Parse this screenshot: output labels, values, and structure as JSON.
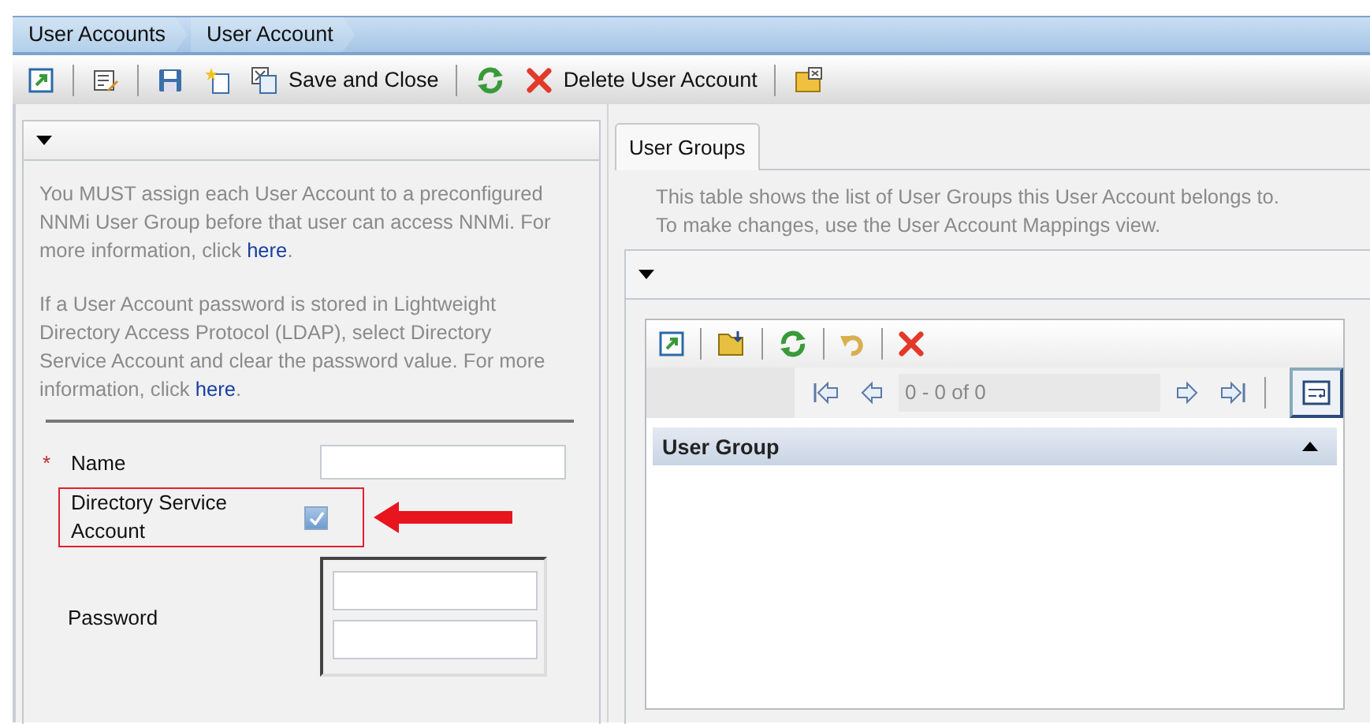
{
  "breadcrumbs": [
    {
      "label": "User Accounts"
    },
    {
      "label": "User Account"
    }
  ],
  "toolbar": {
    "save_close_label": "Save and Close",
    "delete_label": "Delete User Account"
  },
  "left_panel": {
    "expanded": true,
    "paragraphs": [
      {
        "text_before": "You MUST assign each User Account to a preconfigured NNMi User Group before that user can access NNMi. For more information, click ",
        "link": "here",
        "text_after": "."
      },
      {
        "text_before": "If a User Account password is stored in Lightweight Directory Access Protocol (LDAP), select Directory Service Account and clear the password value. For more information, click ",
        "link": "here",
        "text_after": "."
      }
    ],
    "name_field": {
      "label": "Name",
      "required_mark": "*"
    },
    "directory_service": {
      "label": "Directory Service Account",
      "checked": true,
      "highlighted": true
    },
    "password_field": {
      "label": "Password"
    }
  },
  "right_panel": {
    "tabs": [
      {
        "label": "User Groups",
        "selected": true
      }
    ],
    "description": [
      "This table shows the list of User Groups this User Account belongs to.",
      "To make changes, use the User Account Mappings view."
    ],
    "expanded": true,
    "pager": {
      "range": "0 - 0 of 0"
    },
    "table": {
      "columns": [
        {
          "label": "User Group",
          "sort_ascending": true
        }
      ]
    }
  }
}
